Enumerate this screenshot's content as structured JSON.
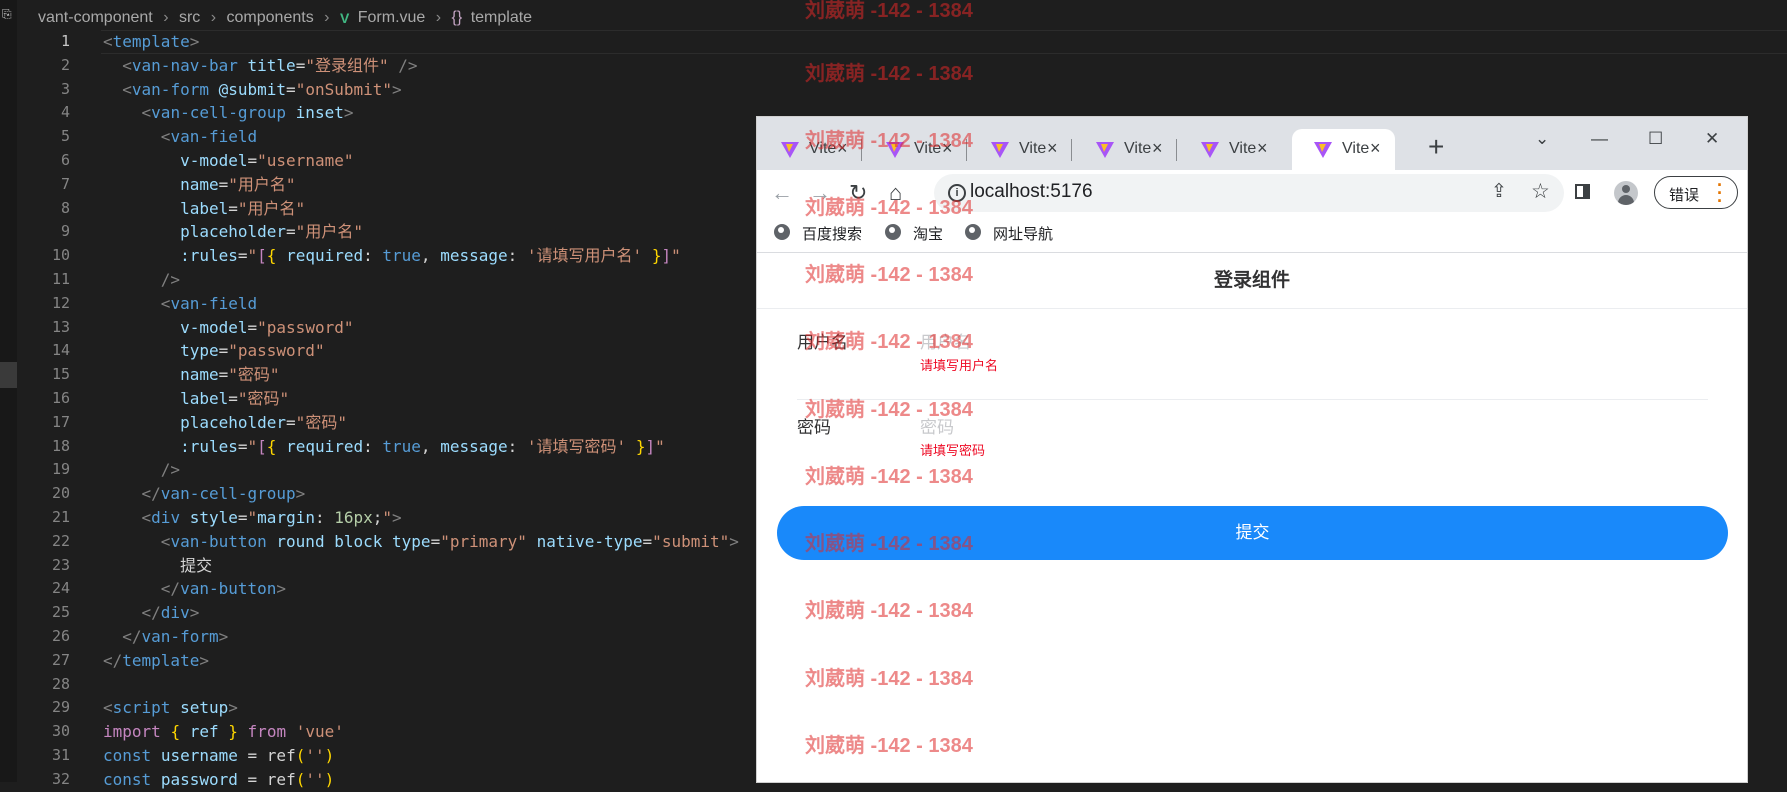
{
  "editor": {
    "breadcrumb": [
      "vant-component",
      "src",
      "components",
      "Form.vue",
      "template"
    ],
    "line_numbers": [
      "1",
      "2",
      "3",
      "4",
      "5",
      "6",
      "7",
      "8",
      "9",
      "10",
      "11",
      "12",
      "13",
      "14",
      "15",
      "16",
      "17",
      "18",
      "19",
      "20",
      "21",
      "22",
      "23",
      "24",
      "25",
      "26",
      "27",
      "28",
      "29",
      "30",
      "31",
      "32"
    ],
    "tokens": {
      "template": "template",
      "van_nav_bar": "van-nav-bar",
      "title_attr": "title",
      "title_val": "登录组件",
      "van_form": "van-form",
      "submit_attr": "@submit",
      "submit_val": "onSubmit",
      "van_cell_group": "van-cell-group",
      "inset": "inset",
      "van_field": "van-field",
      "v_model": "v-model",
      "username": "username",
      "name_attr": "name",
      "label_attr": "label",
      "placeholder_attr": "placeholder",
      "rules_attr": ":rules",
      "username_cn": "用户名",
      "required": "required",
      "true_kw": "true",
      "message": "message",
      "msg_username": "'请填写用户名'",
      "password": "password",
      "type_attr": "type",
      "password_cn": "密码",
      "msg_password": "'请填写密码'",
      "div": "div",
      "style_attr": "style",
      "style_prop": "margin",
      "style_num": "16px",
      "van_button": "van-button",
      "round": "round",
      "block": "block",
      "primary": "primary",
      "native_type": "native-type",
      "submit": "submit",
      "submit_text": "提交",
      "script": "script",
      "setup": "setup",
      "import_kw": "import",
      "ref": "ref",
      "from_kw": "from",
      "vue_str": "'vue'",
      "const_kw": "const",
      "empty_str": "''",
      "password_var": "password"
    }
  },
  "browser": {
    "tabs": [
      {
        "title": "Vite"
      },
      {
        "title": "Vite"
      },
      {
        "title": "Vite"
      },
      {
        "title": "Vite"
      },
      {
        "title": "Vite"
      },
      {
        "title": "Vite"
      }
    ],
    "close_glyph": "×",
    "newtab_glyph": "+",
    "url": "localhost:5176",
    "error_label": "错误",
    "bookmarks": [
      "百度搜索",
      "淘宝",
      "网址导航"
    ]
  },
  "page": {
    "nav_title": "登录组件",
    "fields": [
      {
        "label": "用户名",
        "placeholder": "用户名",
        "error": "请填写用户名"
      },
      {
        "label": "密码",
        "placeholder": "密码",
        "error": "请填写密码"
      }
    ],
    "submit_label": "提交"
  },
  "watermark": {
    "text": "刘葳萌 -142 - 1384"
  },
  "colors": {
    "accent": "#1989fa",
    "error": "#ee0a24",
    "editor_bg": "#1e1e1e"
  }
}
